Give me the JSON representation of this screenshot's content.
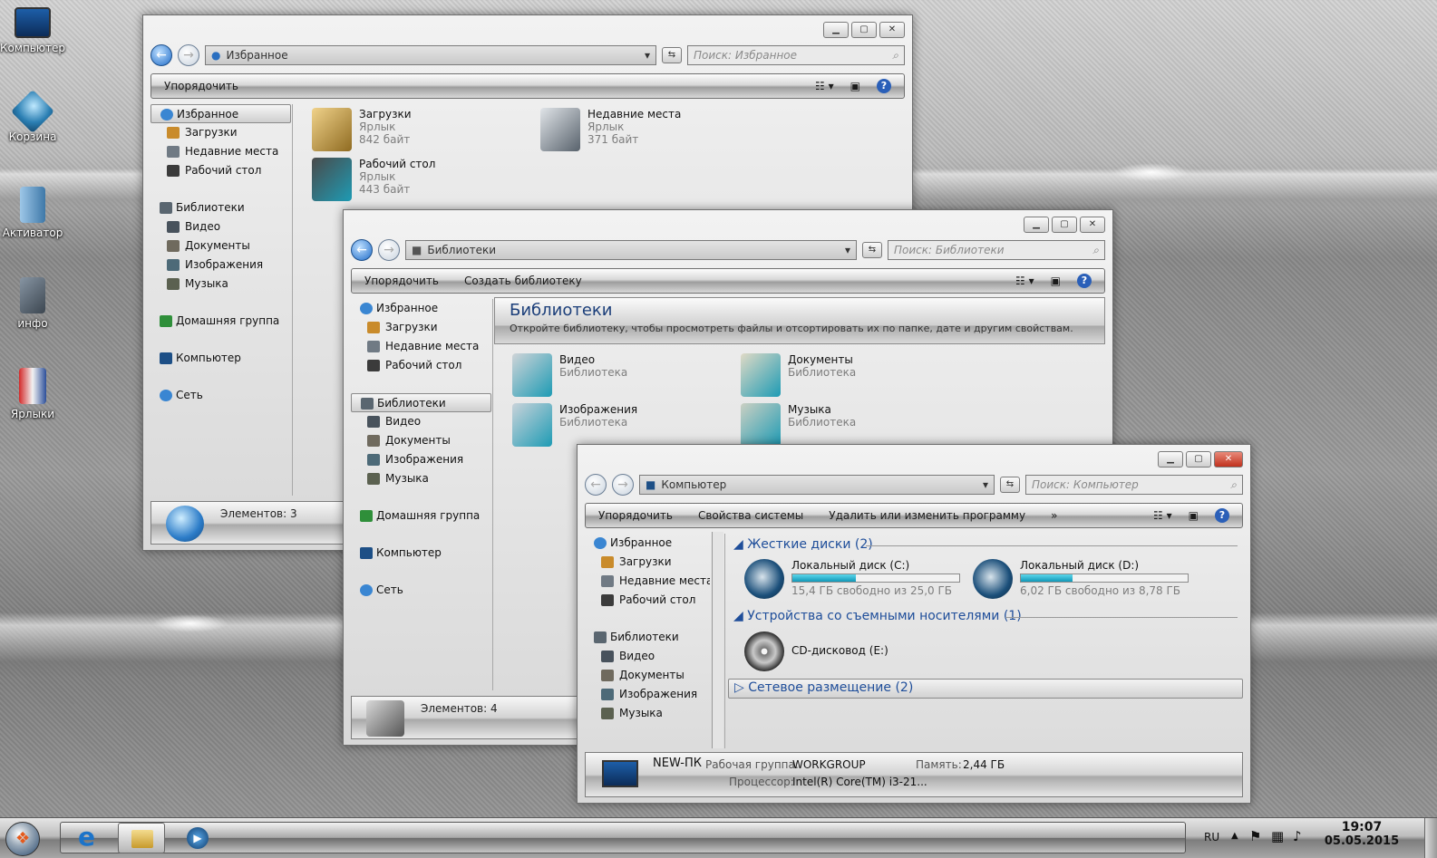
{
  "desktop": {
    "icons": [
      {
        "label": "Компьютер"
      },
      {
        "label": "Корзина"
      },
      {
        "label": "Активатор"
      },
      {
        "label": "инфо"
      },
      {
        "label": "Ярлыки"
      }
    ]
  },
  "window1": {
    "address": "Избранное",
    "search_placeholder": "Поиск: Избранное",
    "toolbar": {
      "organize": "Упорядочить"
    },
    "nav": {
      "favorites": "Избранное",
      "downloads": "Загрузки",
      "recent": "Недавние места",
      "desktop": "Рабочий стол",
      "libraries": "Библиотеки",
      "video": "Видео",
      "documents": "Документы",
      "images": "Изображения",
      "music": "Музыка",
      "homegroup": "Домашняя группа",
      "computer": "Компьютер",
      "network": "Сеть"
    },
    "items": [
      {
        "name": "Загрузки",
        "type": "Ярлык",
        "size": "842 байт"
      },
      {
        "name": "Недавние места",
        "type": "Ярлык",
        "size": "371 байт"
      },
      {
        "name": "Рабочий стол",
        "type": "Ярлык",
        "size": "443 байт"
      }
    ],
    "status": "Элементов: 3"
  },
  "window2": {
    "address": "Библиотеки",
    "search_placeholder": "Поиск: Библиотеки",
    "toolbar": {
      "organize": "Упорядочить",
      "create": "Создать библиотеку"
    },
    "banner": {
      "title": "Библиотеки",
      "desc": "Откройте библиотеку, чтобы просмотреть файлы и отсортировать их по папке, дате и другим свойствам."
    },
    "nav": {
      "favorites": "Избранное",
      "downloads": "Загрузки",
      "recent": "Недавние места",
      "desktop": "Рабочий стол",
      "libraries": "Библиотеки",
      "video": "Видео",
      "documents": "Документы",
      "images": "Изображения",
      "music": "Музыка",
      "homegroup": "Домашняя группа",
      "computer": "Компьютер",
      "network": "Сеть"
    },
    "items": [
      {
        "name": "Видео",
        "type": "Библиотека"
      },
      {
        "name": "Документы",
        "type": "Библиотека"
      },
      {
        "name": "Изображения",
        "type": "Библиотека"
      },
      {
        "name": "Музыка",
        "type": "Библиотека"
      }
    ],
    "status": "Элементов: 4"
  },
  "window3": {
    "address": "Компьютер",
    "search_placeholder": "Поиск: Компьютер",
    "toolbar": {
      "organize": "Упорядочить",
      "system": "Свойства системы",
      "uninstall": "Удалить или изменить программу",
      "more": "»"
    },
    "nav": {
      "favorites": "Избранное",
      "downloads": "Загрузки",
      "recent": "Недавние места",
      "desktop": "Рабочий стол",
      "libraries": "Библиотеки",
      "video": "Видео",
      "documents": "Документы",
      "images": "Изображения",
      "music": "Музыка"
    },
    "sections": {
      "hdd": "Жесткие диски (2)",
      "removable": "Устройства со съемными носителями (1)",
      "network": "Сетевое размещение (2)"
    },
    "drives": [
      {
        "name": "Локальный диск (C:)",
        "free": "15,4 ГБ свободно из 25,0 ГБ",
        "used_fraction": 0.38
      },
      {
        "name": "Локальный диск (D:)",
        "free": "6,02 ГБ свободно из 8,78 ГБ",
        "used_fraction": 0.31
      }
    ],
    "cd": {
      "name": "CD-дисковод (E:)"
    },
    "details": {
      "pc_name": "NEW-ПК",
      "workgroup_label": "Рабочая группа:",
      "workgroup": "WORKGROUP",
      "memory_label": "Память:",
      "memory": "2,44 ГБ",
      "cpu_label": "Процессор:",
      "cpu": "Intel(R) Core(TM) i3-21..."
    }
  },
  "taskbar": {
    "lang": "RU",
    "time": "19:07",
    "date": "05.05.2015"
  }
}
